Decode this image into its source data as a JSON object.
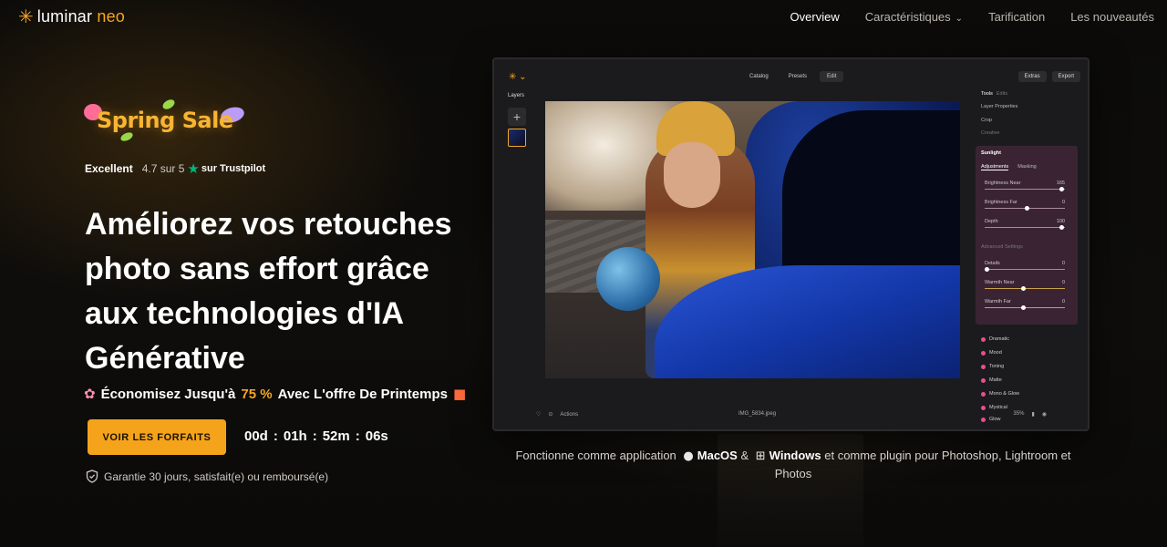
{
  "nav": {
    "logo_main": "luminar",
    "logo_neo": "neo",
    "links": [
      {
        "label": "Overview"
      },
      {
        "label": "Caractéristiques"
      },
      {
        "label": "Tarification"
      },
      {
        "label": "Les nouveautés"
      }
    ]
  },
  "hero": {
    "sale_badge": "Spring Sale",
    "trust_excellent": "Excellent",
    "trust_rating": "4.7 sur 5",
    "trust_source": "sur Trustpilot",
    "headline": "Améliorez vos retouches photo sans effort grâce aux technologies d'IA Générative",
    "offer_prefix": "Économisez Jusqu'à",
    "offer_percent": "75 %",
    "offer_suffix": "Avec L'offre De Printemps",
    "cta_label": "VOIR LES FORFAITS",
    "countdown": {
      "days": "00d",
      "hours": "01h",
      "minutes": "52m",
      "seconds": "06s"
    },
    "guarantee": "Garantie 30 jours, satisfait(e) ou remboursé(e)"
  },
  "app": {
    "tabs": [
      "Catalog",
      "Presets",
      "Edit"
    ],
    "actions": [
      "Extras",
      "Export"
    ],
    "layers_title": "Layers",
    "bottom_actions": "Actions",
    "file_name": "IMG_5834.jpeg",
    "zoom": "35%",
    "panel": {
      "tools": "Tools",
      "edits": "Edits",
      "layer_properties": "Layer Properties",
      "crop": "Crop",
      "creative": "Creative",
      "selected_tool": "Sunlight",
      "tab_adjustments": "Adjustments",
      "tab_masking": "Masking",
      "sliders": [
        {
          "label": "Brightness Near",
          "value": "165"
        },
        {
          "label": "Brightness Far",
          "value": "0"
        },
        {
          "label": "Depth",
          "value": "100"
        }
      ],
      "advanced": "Advanced Settings",
      "adv_sliders": [
        {
          "label": "Details",
          "value": "0"
        },
        {
          "label": "Warmth Near",
          "value": "0"
        },
        {
          "label": "Warmth Far",
          "value": "0"
        }
      ],
      "items": [
        "Dramatic",
        "Mood",
        "Toning",
        "Matte",
        "Mono & Glow",
        "Mystical",
        "Glow"
      ]
    }
  },
  "works_with": {
    "prefix": "Fonctionne comme application",
    "mac": "MacOS",
    "amp": "&",
    "windows": "Windows",
    "suffix": "et comme plugin pour Photoshop, Lightroom et Photos"
  }
}
